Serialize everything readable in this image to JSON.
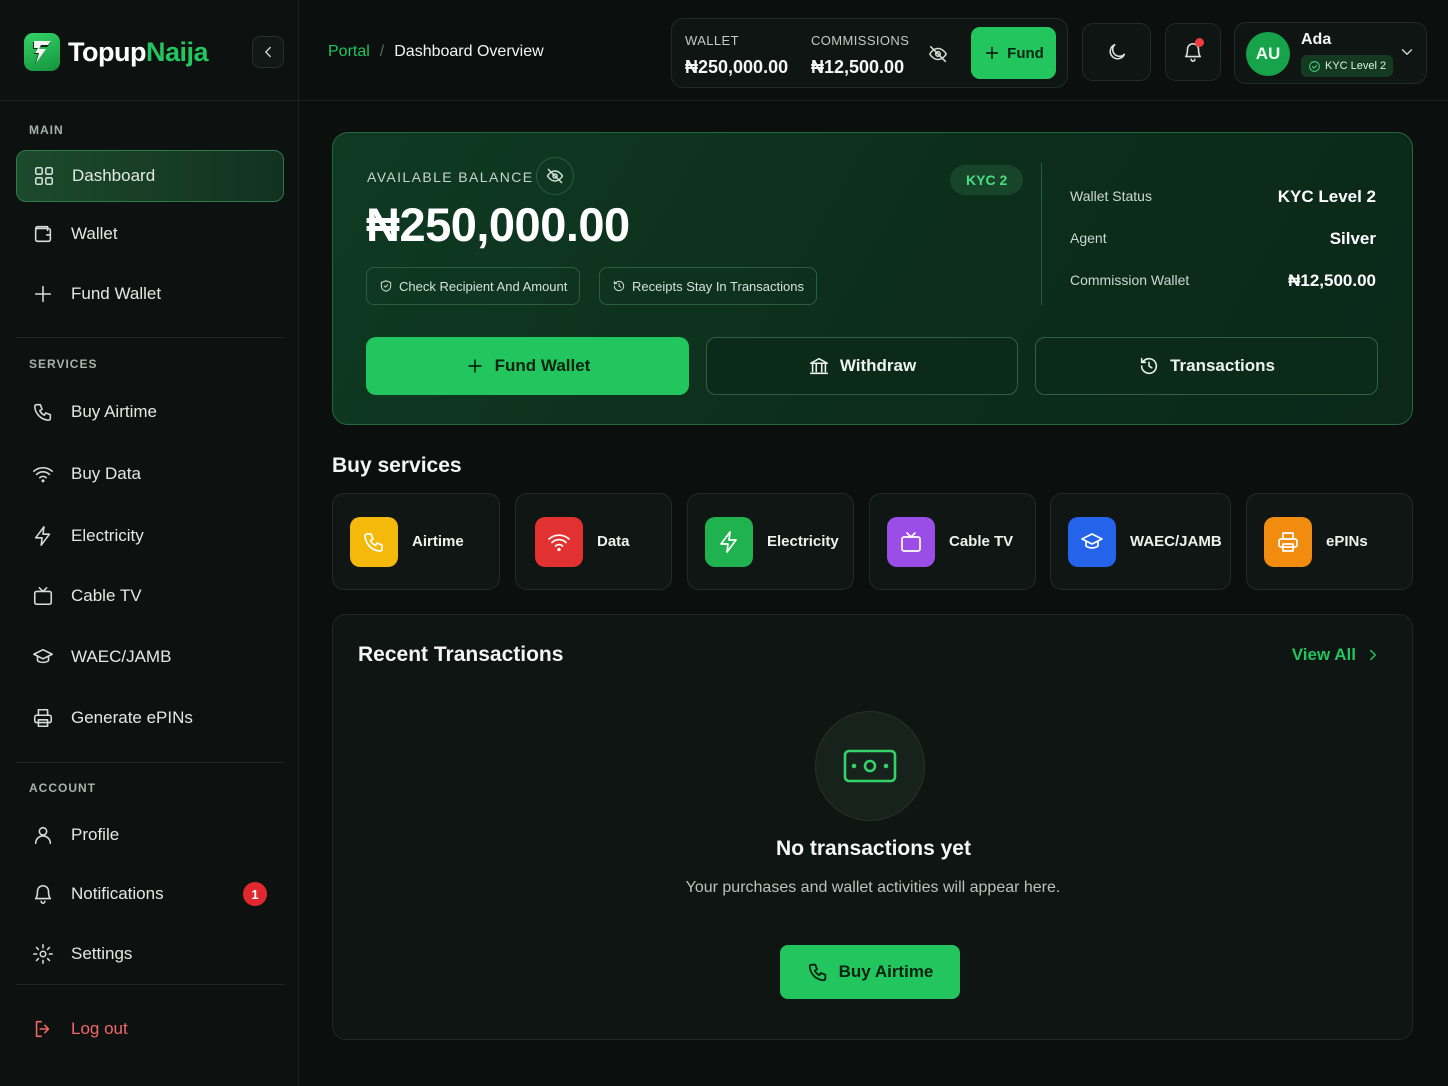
{
  "brand": {
    "name_part1": "Topup",
    "name_part2": "Naija"
  },
  "sidebar": {
    "sections": {
      "main": "MAIN",
      "services": "SERVICES",
      "account": "ACCOUNT"
    },
    "items": {
      "dashboard": "Dashboard",
      "wallet": "Wallet",
      "fund_wallet": "Fund Wallet",
      "buy_airtime": "Buy Airtime",
      "buy_data": "Buy Data",
      "electricity": "Electricity",
      "cable_tv": "Cable TV",
      "waec_jamb": "WAEC/JAMB",
      "generate_epins": "Generate ePINs",
      "profile": "Profile",
      "notifications": "Notifications",
      "settings": "Settings",
      "logout": "Log out"
    },
    "notifications_badge": "1",
    "active_item": "dashboard"
  },
  "header": {
    "breadcrumb": {
      "root": "Portal",
      "separator": "/",
      "current": "Dashboard Overview"
    },
    "wallet_label": "WALLET",
    "wallet_value": "₦250,000.00",
    "commissions_label": "COMMISSIONS",
    "commissions_value": "₦12,500.00",
    "fund_label": "Fund",
    "user": {
      "initials": "AU",
      "name": "Ada",
      "kyc": "KYC Level 2"
    },
    "notification_dot": true
  },
  "balance_card": {
    "label": "AVAILABLE BALANCE",
    "amount": "₦250,000.00",
    "kyc_pill": "KYC 2",
    "chips": {
      "check": "Check Recipient And Amount",
      "receipts": "Receipts Stay In Transactions"
    },
    "stats": {
      "wallet_status_label": "Wallet Status",
      "wallet_status_value": "KYC Level 2",
      "agent_label": "Agent",
      "agent_value": "Silver",
      "commission_label": "Commission Wallet",
      "commission_value": "₦12,500.00"
    },
    "actions": {
      "fund": "Fund Wallet",
      "withdraw": "Withdraw",
      "transactions": "Transactions"
    }
  },
  "services": {
    "title": "Buy services",
    "items": {
      "airtime": "Airtime",
      "data": "Data",
      "electricity": "Electricity",
      "cable_tv": "Cable TV",
      "waec_jamb": "WAEC/JAMB",
      "epins": "ePINs"
    },
    "colors": {
      "airtime": "#f5b90b",
      "data": "#e23131",
      "electricity": "#1fb24f",
      "cable_tv": "#9b4de8",
      "waec_jamb": "#2563eb",
      "epins": "#f28c0f"
    }
  },
  "transactions": {
    "title": "Recent Transactions",
    "view_all": "View All",
    "empty_title": "No transactions yet",
    "empty_subtitle": "Your purchases and wallet activities will appear here.",
    "empty_button": "Buy Airtime"
  },
  "theme": {
    "accent": "#22c55e",
    "background": "#0b0f0d",
    "danger": "#e0282e"
  }
}
